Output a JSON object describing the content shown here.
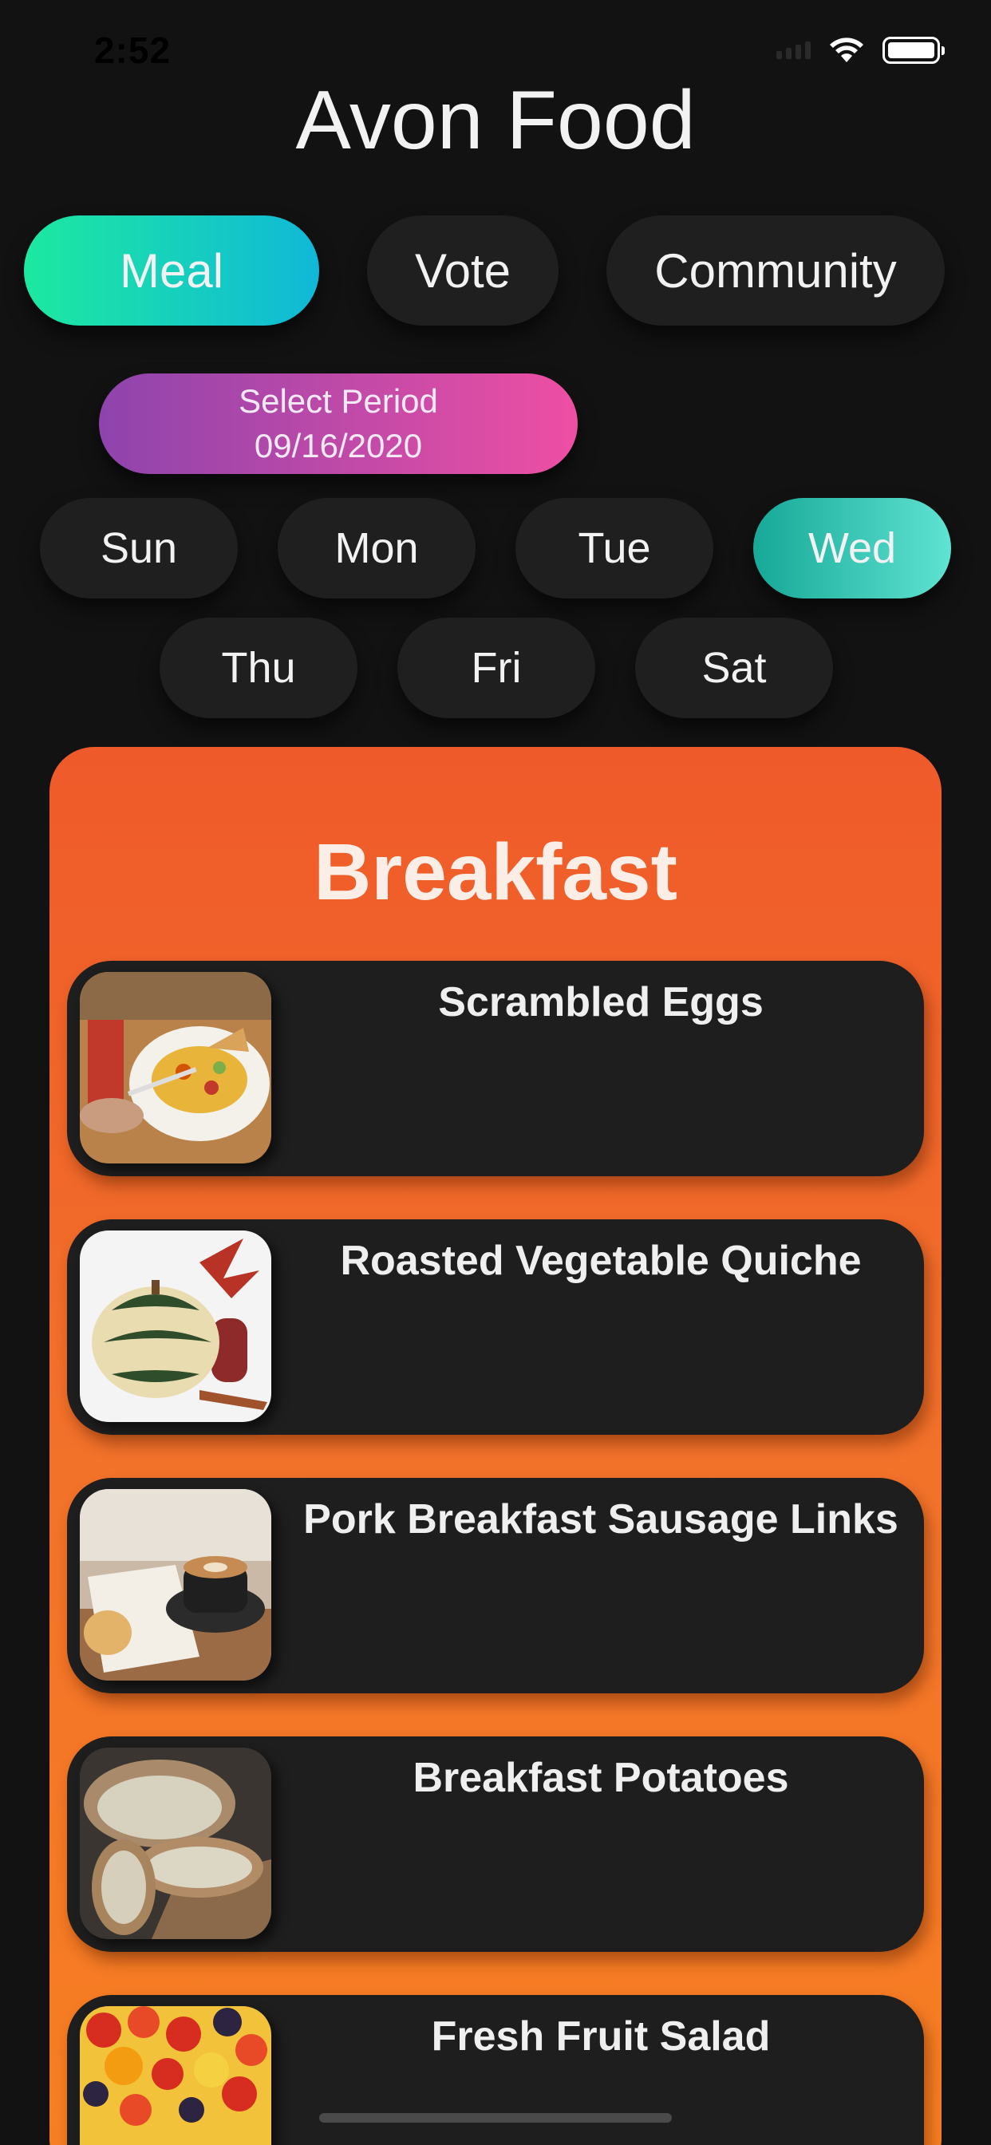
{
  "status_bar": {
    "time": "2:52"
  },
  "app": {
    "title": "Avon Food"
  },
  "tabs": [
    {
      "label": "Meal",
      "selected": true
    },
    {
      "label": "Vote",
      "selected": false
    },
    {
      "label": "Community",
      "selected": false
    }
  ],
  "period": {
    "label": "Select Period",
    "date": "09/16/2020"
  },
  "days": [
    {
      "label": "Sun",
      "selected": false
    },
    {
      "label": "Mon",
      "selected": false
    },
    {
      "label": "Tue",
      "selected": false
    },
    {
      "label": "Wed",
      "selected": true
    },
    {
      "label": "Thu",
      "selected": false
    },
    {
      "label": "Fri",
      "selected": false
    },
    {
      "label": "Sat",
      "selected": false
    }
  ],
  "meal": {
    "title": "Breakfast",
    "items": [
      {
        "name": "Scrambled Eggs",
        "image": "scrambled-eggs-photo"
      },
      {
        "name": "Roasted Vegetable Quiche",
        "image": "squash-photo"
      },
      {
        "name": "Pork Breakfast Sausage Links",
        "image": "coffee-photo"
      },
      {
        "name": "Breakfast Potatoes",
        "image": "bread-photo"
      },
      {
        "name": "Fresh Fruit Salad",
        "image": "fruit-tart-photo"
      }
    ]
  },
  "colors": {
    "background": "#121212",
    "meal_tab_gradient": [
      "#1de9a0",
      "#10b8d8"
    ],
    "period_gradient": [
      "#8e44ad",
      "#ee4fa3"
    ],
    "selected_day_gradient": [
      "#17a897",
      "#5fe3d2"
    ],
    "card_gradient": [
      "#ef5a2a",
      "#f77f22"
    ],
    "pill": "#1f1f1f"
  }
}
